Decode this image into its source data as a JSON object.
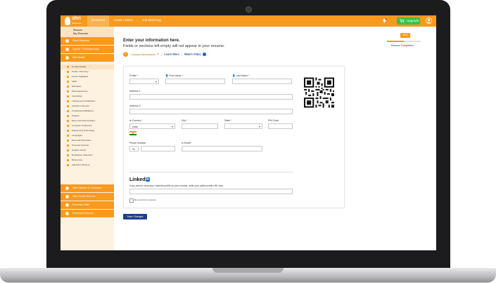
{
  "topbar": {
    "logo_text": "shri",
    "logo_subtext": "placement",
    "nav": [
      "Resumes",
      "Cover Letters",
      "Job Matching"
    ],
    "upgrade_label": "Upgrade"
  },
  "sidebar": {
    "title": "Resume",
    "subtitle": "My Resume",
    "main_items": [
      "Send Resumes",
      "Layout + Summary Area",
      "Edit Details",
      "Hide Resume & Customize",
      "View Online Resume",
      "Summary Table",
      "Download Resume"
    ],
    "sub_items": [
      "Contact Details",
      "Profile / Pitch Key",
      "Career Highlights",
      "Skills",
      "Education",
      "Work Experience",
      "Internships",
      "Training and Certification",
      "Awards & Honours",
      "Professional Affiliations",
      "Projects",
      "Extra Curricular Activities",
      "Computer Proficiency",
      "Engineering Technology",
      "Languages",
      "Personal Information",
      "Personal Interests",
      "Graphic Charts",
      "Declaration Statement",
      "References",
      "Add More Sections"
    ]
  },
  "main": {
    "heading": "Enter your information here.",
    "subheading": "Fields or sections left empty will not appear in your resume.",
    "contact_link": "Contact Information",
    "learn_more": "Learn More",
    "watch_video": "Watch Video",
    "progress_badge": "50%",
    "progress_fraction": 0.5,
    "progress_label": "Resume Completion"
  },
  "form": {
    "profile_label": "Profile",
    "first_name_label": "First Name",
    "last_name_label": "Last Name",
    "address1_label": "Address 1",
    "address2_label": "Address 2",
    "country_label": "Country",
    "country_value": "India",
    "city_label": "City",
    "state_label": "State",
    "pin_label": "PIN Code",
    "phone_label": "Phone Number",
    "phone_code": "91",
    "email_label": "Email",
    "linkedin_word": "Linked",
    "linkedin_in": "in",
    "linkedin_help": "If you wish to show your LinkedIn profile on your resume, enter your public profile URL here.",
    "dont_print_label": "Do not print on resume",
    "save_label": "Save Changes"
  },
  "colors": {
    "brand_orange": "#f79a1e",
    "save_button": "#1f3f86",
    "upgrade_green": "#3cbf4a"
  }
}
